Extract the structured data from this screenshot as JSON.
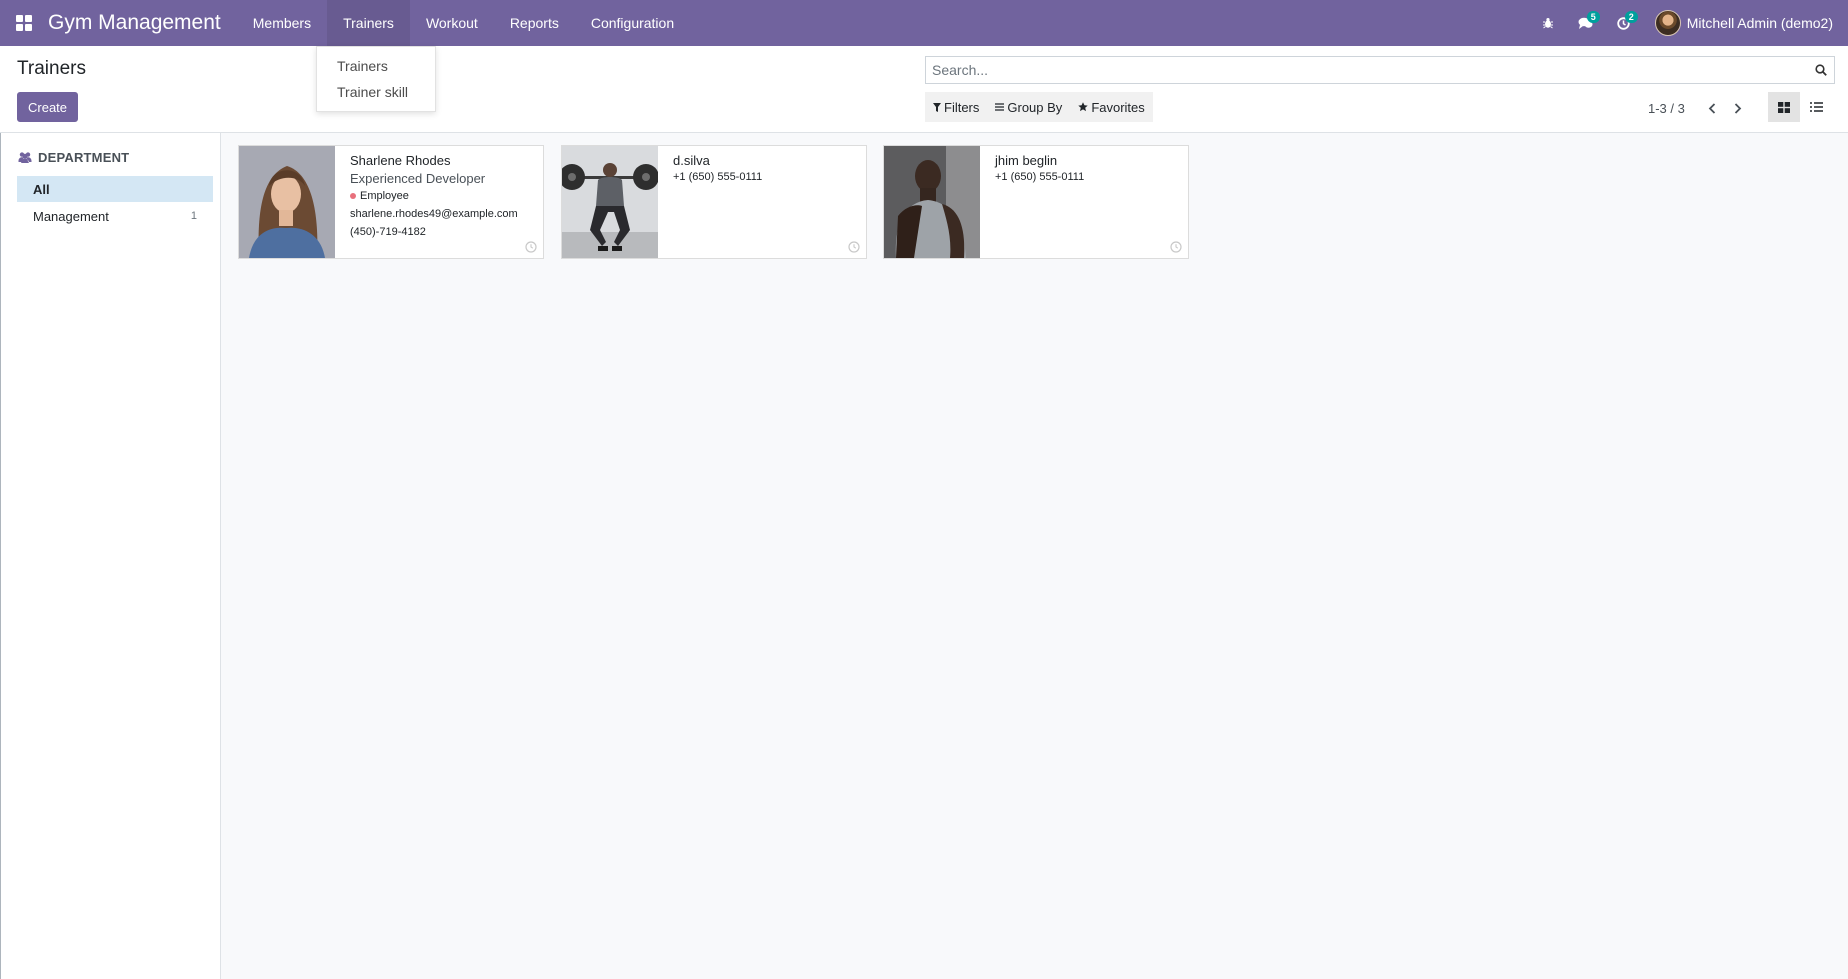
{
  "app": {
    "name": "Gym Management"
  },
  "menu": [
    {
      "label": "Members",
      "active": false
    },
    {
      "label": "Trainers",
      "active": true
    },
    {
      "label": "Workout",
      "active": false
    },
    {
      "label": "Reports",
      "active": false
    },
    {
      "label": "Configuration",
      "active": false
    }
  ],
  "dropdown": {
    "items": [
      "Trainers",
      "Trainer skill"
    ]
  },
  "systray": {
    "messages_count": "5",
    "activities_count": "2",
    "user_name": "Mitchell Admin (demo2)"
  },
  "control": {
    "title": "Trainers",
    "create_label": "Create",
    "search_placeholder": "Search...",
    "filters_label": "Filters",
    "groupby_label": "Group By",
    "favorites_label": "Favorites",
    "pager_value": "1-3 / 3"
  },
  "sidebar": {
    "header": "DEPARTMENT",
    "items": [
      {
        "label": "All",
        "count": "",
        "active": true
      },
      {
        "label": "Management",
        "count": "1",
        "active": false
      }
    ]
  },
  "cards": [
    {
      "name": "Sharlene Rhodes",
      "job": "Experienced Developer",
      "tag": "Employee",
      "email": "sharlene.rhodes49@example.com",
      "phone": "(450)-719-4182"
    },
    {
      "name": "d.silva",
      "phone": "+1 (650) 555-0111"
    },
    {
      "name": "jhim beglin",
      "phone": "+1 (650) 555-0111"
    }
  ],
  "colors": {
    "brand": "#71639e",
    "badge": "#00a09d",
    "sidebar_active": "#d4e7f4",
    "tag_dot": "#e8707c"
  },
  "icons": [
    "apps-icon",
    "bug-icon",
    "chat-icon",
    "clock-icon",
    "search-icon",
    "filter-icon",
    "group-by-icon",
    "star-icon",
    "chevron-left-icon",
    "chevron-right-icon",
    "kanban-view-icon",
    "list-view-icon",
    "users-icon"
  ]
}
